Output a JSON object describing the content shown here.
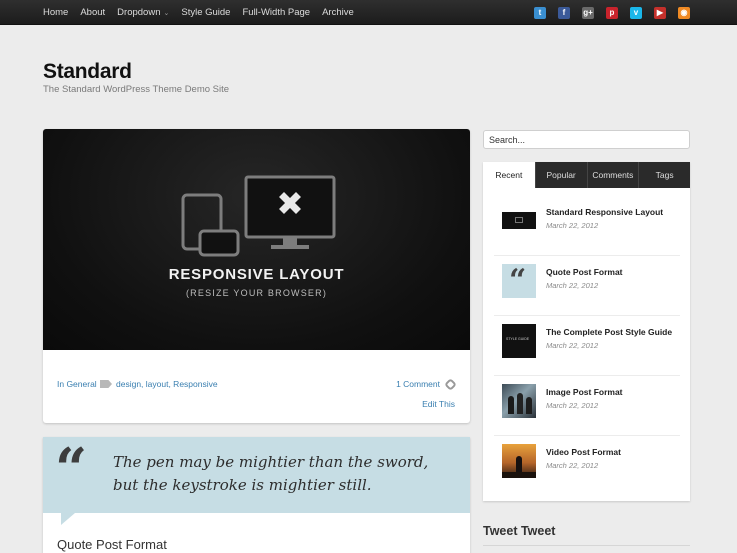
{
  "nav": {
    "items": [
      {
        "label": "Home"
      },
      {
        "label": "About"
      },
      {
        "label": "Dropdown",
        "has_caret": true
      },
      {
        "label": "Style Guide"
      },
      {
        "label": "Full-Width Page"
      },
      {
        "label": "Archive"
      }
    ],
    "caret": "⌄"
  },
  "social": [
    {
      "icon": "twitter-icon",
      "glyph": "t",
      "color": "#3a8fd1"
    },
    {
      "icon": "facebook-icon",
      "glyph": "f",
      "color": "#3b5a99"
    },
    {
      "icon": "google-plus-icon",
      "glyph": "g+",
      "color": "#6a6a6a"
    },
    {
      "icon": "pinterest-icon",
      "glyph": "p",
      "color": "#c8232c"
    },
    {
      "icon": "vimeo-icon",
      "glyph": "v",
      "color": "#1ab7ea"
    },
    {
      "icon": "youtube-icon",
      "glyph": "▶",
      "color": "#c4302b"
    },
    {
      "icon": "rss-icon",
      "glyph": "◉",
      "color": "#f08a24"
    }
  ],
  "site": {
    "title": "Standard",
    "description": "The Standard WordPress Theme Demo Site"
  },
  "post1": {
    "image_title": "RESPONSIVE LAYOUT",
    "image_subtitle": "(RESIZE YOUR BROWSER)",
    "category": "In General",
    "tags": "design, layout, Responsive",
    "comments": "1 Comment",
    "edit": "Edit This"
  },
  "post2": {
    "quote": "The pen may be mightier than the sword, but the keystroke is mightier still.",
    "quote_mark": "“",
    "title": "Quote Post Format"
  },
  "sidebar": {
    "search_placeholder": "Search...",
    "tabs": [
      {
        "label": "Recent",
        "active": true
      },
      {
        "label": "Popular"
      },
      {
        "label": "Comments"
      },
      {
        "label": "Tags"
      }
    ],
    "recent": [
      {
        "title": "Standard Responsive Layout",
        "date": "March 22, 2012",
        "thumb": "responsive-thumbnail"
      },
      {
        "title": "Quote Post Format",
        "date": "March 22, 2012",
        "thumb": "quote-thumbnail"
      },
      {
        "title": "The Complete Post Style Guide",
        "date": "March 22, 2012",
        "thumb": "style-guide-thumbnail",
        "thumb_text": "STYLE GUIDE"
      },
      {
        "title": "Image Post Format",
        "date": "March 22, 2012",
        "thumb": "image-thumbnail"
      },
      {
        "title": "Video Post Format",
        "date": "March 22, 2012",
        "thumb": "video-thumbnail"
      }
    ],
    "tweet_title": "Tweet Tweet"
  }
}
